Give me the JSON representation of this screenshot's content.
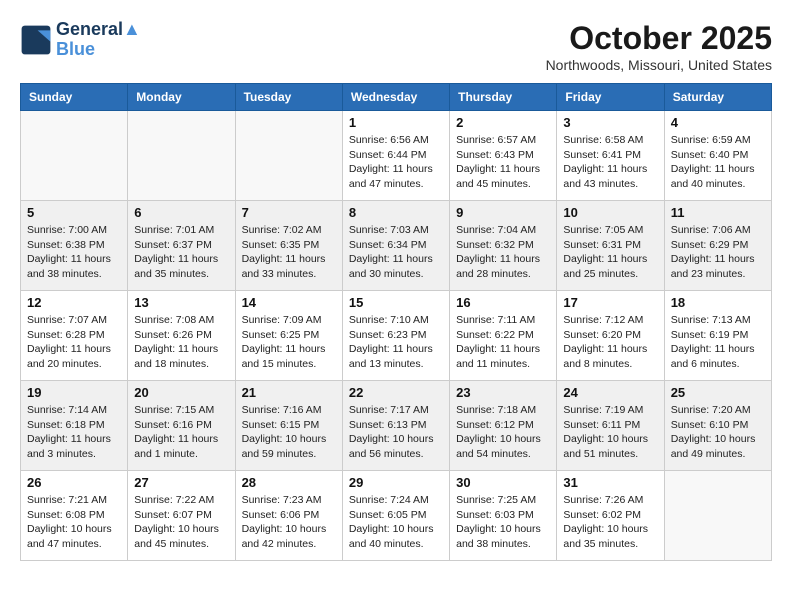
{
  "header": {
    "logo_line1": "General",
    "logo_line2": "Blue",
    "month_title": "October 2025",
    "location": "Northwoods, Missouri, United States"
  },
  "days_of_week": [
    "Sunday",
    "Monday",
    "Tuesday",
    "Wednesday",
    "Thursday",
    "Friday",
    "Saturday"
  ],
  "weeks": [
    [
      {
        "day": "",
        "info": ""
      },
      {
        "day": "",
        "info": ""
      },
      {
        "day": "",
        "info": ""
      },
      {
        "day": "1",
        "info": "Sunrise: 6:56 AM\nSunset: 6:44 PM\nDaylight: 11 hours\nand 47 minutes."
      },
      {
        "day": "2",
        "info": "Sunrise: 6:57 AM\nSunset: 6:43 PM\nDaylight: 11 hours\nand 45 minutes."
      },
      {
        "day": "3",
        "info": "Sunrise: 6:58 AM\nSunset: 6:41 PM\nDaylight: 11 hours\nand 43 minutes."
      },
      {
        "day": "4",
        "info": "Sunrise: 6:59 AM\nSunset: 6:40 PM\nDaylight: 11 hours\nand 40 minutes."
      }
    ],
    [
      {
        "day": "5",
        "info": "Sunrise: 7:00 AM\nSunset: 6:38 PM\nDaylight: 11 hours\nand 38 minutes."
      },
      {
        "day": "6",
        "info": "Sunrise: 7:01 AM\nSunset: 6:37 PM\nDaylight: 11 hours\nand 35 minutes."
      },
      {
        "day": "7",
        "info": "Sunrise: 7:02 AM\nSunset: 6:35 PM\nDaylight: 11 hours\nand 33 minutes."
      },
      {
        "day": "8",
        "info": "Sunrise: 7:03 AM\nSunset: 6:34 PM\nDaylight: 11 hours\nand 30 minutes."
      },
      {
        "day": "9",
        "info": "Sunrise: 7:04 AM\nSunset: 6:32 PM\nDaylight: 11 hours\nand 28 minutes."
      },
      {
        "day": "10",
        "info": "Sunrise: 7:05 AM\nSunset: 6:31 PM\nDaylight: 11 hours\nand 25 minutes."
      },
      {
        "day": "11",
        "info": "Sunrise: 7:06 AM\nSunset: 6:29 PM\nDaylight: 11 hours\nand 23 minutes."
      }
    ],
    [
      {
        "day": "12",
        "info": "Sunrise: 7:07 AM\nSunset: 6:28 PM\nDaylight: 11 hours\nand 20 minutes."
      },
      {
        "day": "13",
        "info": "Sunrise: 7:08 AM\nSunset: 6:26 PM\nDaylight: 11 hours\nand 18 minutes."
      },
      {
        "day": "14",
        "info": "Sunrise: 7:09 AM\nSunset: 6:25 PM\nDaylight: 11 hours\nand 15 minutes."
      },
      {
        "day": "15",
        "info": "Sunrise: 7:10 AM\nSunset: 6:23 PM\nDaylight: 11 hours\nand 13 minutes."
      },
      {
        "day": "16",
        "info": "Sunrise: 7:11 AM\nSunset: 6:22 PM\nDaylight: 11 hours\nand 11 minutes."
      },
      {
        "day": "17",
        "info": "Sunrise: 7:12 AM\nSunset: 6:20 PM\nDaylight: 11 hours\nand 8 minutes."
      },
      {
        "day": "18",
        "info": "Sunrise: 7:13 AM\nSunset: 6:19 PM\nDaylight: 11 hours\nand 6 minutes."
      }
    ],
    [
      {
        "day": "19",
        "info": "Sunrise: 7:14 AM\nSunset: 6:18 PM\nDaylight: 11 hours\nand 3 minutes."
      },
      {
        "day": "20",
        "info": "Sunrise: 7:15 AM\nSunset: 6:16 PM\nDaylight: 11 hours\nand 1 minute."
      },
      {
        "day": "21",
        "info": "Sunrise: 7:16 AM\nSunset: 6:15 PM\nDaylight: 10 hours\nand 59 minutes."
      },
      {
        "day": "22",
        "info": "Sunrise: 7:17 AM\nSunset: 6:13 PM\nDaylight: 10 hours\nand 56 minutes."
      },
      {
        "day": "23",
        "info": "Sunrise: 7:18 AM\nSunset: 6:12 PM\nDaylight: 10 hours\nand 54 minutes."
      },
      {
        "day": "24",
        "info": "Sunrise: 7:19 AM\nSunset: 6:11 PM\nDaylight: 10 hours\nand 51 minutes."
      },
      {
        "day": "25",
        "info": "Sunrise: 7:20 AM\nSunset: 6:10 PM\nDaylight: 10 hours\nand 49 minutes."
      }
    ],
    [
      {
        "day": "26",
        "info": "Sunrise: 7:21 AM\nSunset: 6:08 PM\nDaylight: 10 hours\nand 47 minutes."
      },
      {
        "day": "27",
        "info": "Sunrise: 7:22 AM\nSunset: 6:07 PM\nDaylight: 10 hours\nand 45 minutes."
      },
      {
        "day": "28",
        "info": "Sunrise: 7:23 AM\nSunset: 6:06 PM\nDaylight: 10 hours\nand 42 minutes."
      },
      {
        "day": "29",
        "info": "Sunrise: 7:24 AM\nSunset: 6:05 PM\nDaylight: 10 hours\nand 40 minutes."
      },
      {
        "day": "30",
        "info": "Sunrise: 7:25 AM\nSunset: 6:03 PM\nDaylight: 10 hours\nand 38 minutes."
      },
      {
        "day": "31",
        "info": "Sunrise: 7:26 AM\nSunset: 6:02 PM\nDaylight: 10 hours\nand 35 minutes."
      },
      {
        "day": "",
        "info": ""
      }
    ]
  ]
}
